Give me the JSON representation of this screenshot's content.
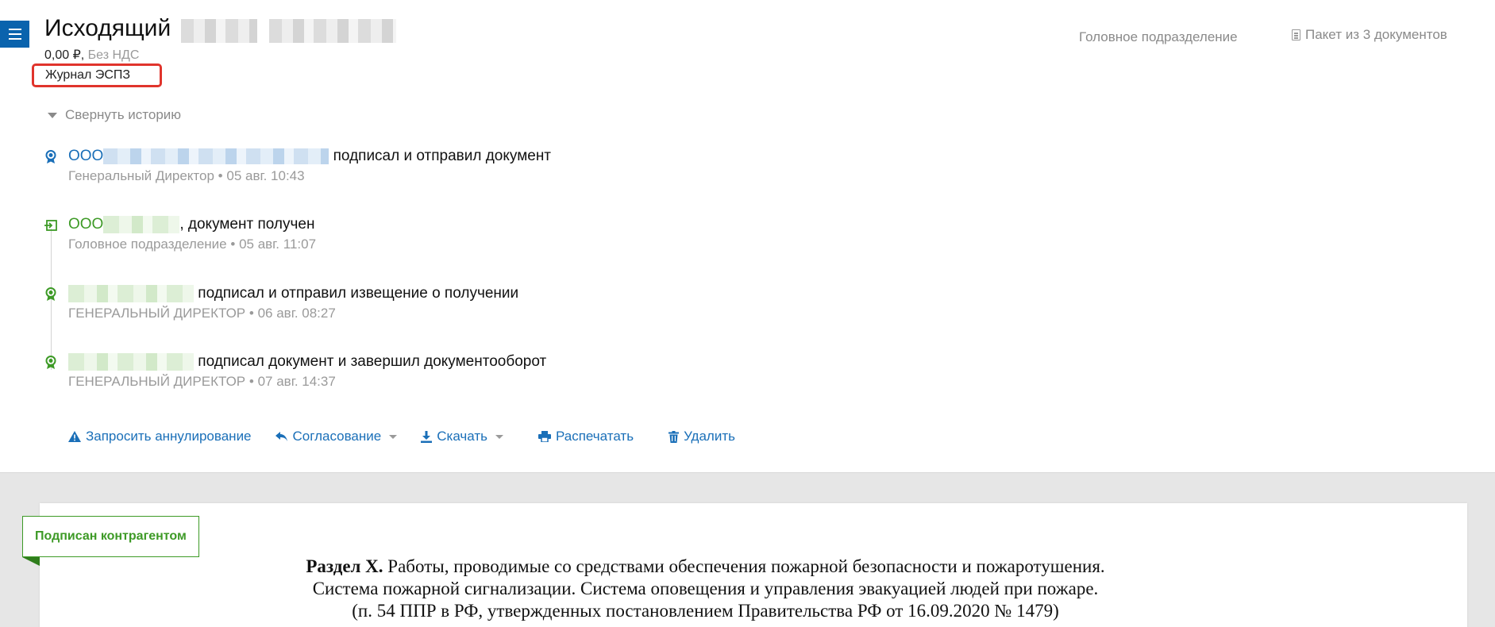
{
  "header": {
    "title": "Исходящий",
    "amount": "0,00 ₽",
    "vat": "Без НДС",
    "journal_label": "Журнал ЭСПЗ",
    "unit": "Головное подразделение",
    "package": "Пакет из 3 документов"
  },
  "history": {
    "collapse_label": "Свернуть историю",
    "events": [
      {
        "org": "ООО",
        "action": "подписал и отправил документ",
        "role": "Генеральный Директор",
        "date": "05 авг. 10:43"
      },
      {
        "org": "ООО",
        "action": ", документ получен",
        "role": "Головное подразделение",
        "date": "05 авг. 11:07"
      },
      {
        "org": "",
        "action": "подписал и отправил извещение о получении",
        "role": "ГЕНЕРАЛЬНЫЙ ДИРЕКТОР",
        "date": "06 авг. 08:27"
      },
      {
        "org": "",
        "action": "подписал документ и завершил документооборот",
        "role": "ГЕНЕРАЛЬНЫЙ ДИРЕКТОР",
        "date": "07 авг. 14:37"
      }
    ],
    "separator": "•"
  },
  "actions": {
    "request_cancel": "Запросить аннулирование",
    "approval": "Согласование",
    "download": "Скачать",
    "print": "Распечатать",
    "delete": "Удалить"
  },
  "document": {
    "status": "Подписан контрагентом",
    "heading_bold": "Раздел X.",
    "line1": "Работы, проводимые со средствами обеспечения пожарной безопасности и пожаротушения.",
    "line2": "Система пожарной сигнализации. Система оповещения и управления эвакуацией людей при пожаре.",
    "line3": "(п. 54 ППР в РФ, утвержденных постановлением Правительства РФ от 16.09.2020 № 1479)"
  },
  "colors": {
    "accent_blue": "#1a6fb8",
    "success_green": "#3d9a26",
    "highlight_red": "#e0342c"
  }
}
